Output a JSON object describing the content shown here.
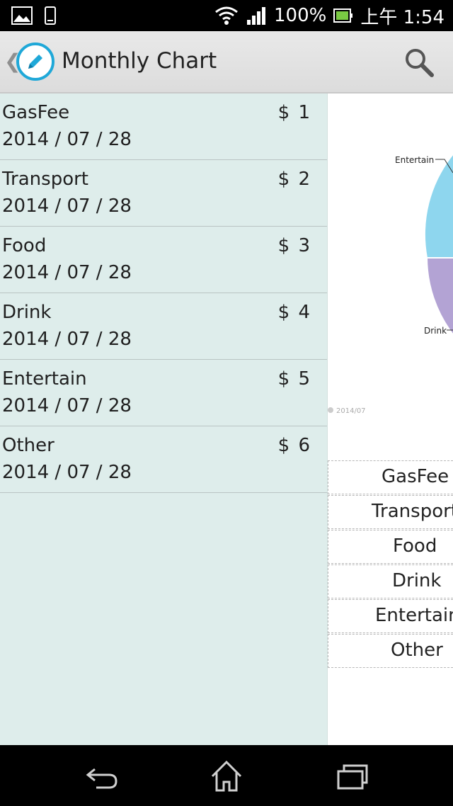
{
  "status_bar": {
    "battery_percent": "100%",
    "time": "上午 1:54",
    "icons": [
      "gallery-icon",
      "phone-icon",
      "wifi-icon",
      "signal-icon",
      "battery-icon"
    ]
  },
  "action_bar": {
    "title": "Monthly Chart",
    "icons": [
      "back-chevron-icon",
      "pencil-icon",
      "search-icon"
    ]
  },
  "expenses": [
    {
      "name": "GasFee",
      "amount": "$ 1",
      "date": "2014 / 07 / 28"
    },
    {
      "name": "Transport",
      "amount": "$ 2",
      "date": "2014 / 07 / 28"
    },
    {
      "name": "Food",
      "amount": "$ 3",
      "date": "2014 / 07 / 28"
    },
    {
      "name": "Drink",
      "amount": "$ 4",
      "date": "2014 / 07 / 28"
    },
    {
      "name": "Entertain",
      "amount": "$ 5",
      "date": "2014 / 07 / 28"
    },
    {
      "name": "Other",
      "amount": "$ 6",
      "date": "2014 / 07 / 28"
    }
  ],
  "chart_data": {
    "type": "pie",
    "series_label": "2014/07",
    "visible_labels": [
      "Entertain",
      "Drink"
    ],
    "categories": [
      "GasFee",
      "Transport",
      "Food",
      "Drink",
      "Entertain",
      "Other"
    ],
    "values": [
      1,
      2,
      3,
      4,
      5,
      6
    ],
    "colors": {
      "Entertain": "#8ed6ee",
      "Drink": "#b3a3d4"
    }
  },
  "legend": [
    "GasFee",
    "Transport",
    "Food",
    "Drink",
    "Entertain",
    "Other"
  ],
  "nav_bar": {
    "icons": [
      "back-icon",
      "home-icon",
      "recent-apps-icon"
    ]
  }
}
